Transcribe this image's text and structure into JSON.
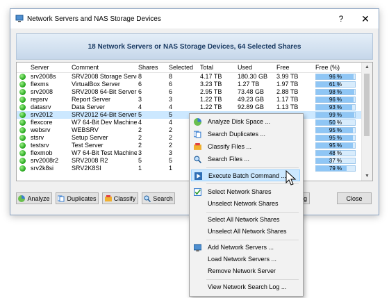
{
  "window": {
    "title": "Network Servers and NAS Storage Devices",
    "help": "?",
    "close": "✕"
  },
  "banner": "18 Network Servers or NAS Storage Devices, 64 Selected Shares",
  "columns": [
    "Server",
    "Comment",
    "Shares",
    "Selected",
    "Total",
    "Used",
    "Free",
    "Free (%)"
  ],
  "rows": [
    {
      "server": "srv2008s",
      "comment": "SRV2008 Storage Server",
      "shares": "8",
      "selected": "8",
      "total": "4.17 TB",
      "used": "180.30 GB",
      "free": "3.99 TB",
      "free_pct": "96 %",
      "fill": 96,
      "selected_row": false
    },
    {
      "server": "flexms",
      "comment": "VirtualBox Server",
      "shares": "6",
      "selected": "6",
      "total": "3.23 TB",
      "used": "1.27 TB",
      "free": "1.97 TB",
      "free_pct": "61 %",
      "fill": 61,
      "selected_row": false
    },
    {
      "server": "srv2008",
      "comment": "SRV2008 64-Bit Server",
      "shares": "6",
      "selected": "6",
      "total": "2.95 TB",
      "used": "73.48 GB",
      "free": "2.88 TB",
      "free_pct": "98 %",
      "fill": 98,
      "selected_row": false
    },
    {
      "server": "repsrv",
      "comment": "Report Server",
      "shares": "3",
      "selected": "3",
      "total": "1.22 TB",
      "used": "49.23 GB",
      "free": "1.17 TB",
      "free_pct": "96 %",
      "fill": 96,
      "selected_row": false
    },
    {
      "server": "datasrv",
      "comment": "Data Server",
      "shares": "4",
      "selected": "4",
      "total": "1.22 TB",
      "used": "92.89 GB",
      "free": "1.13 TB",
      "free_pct": "93 %",
      "fill": 93,
      "selected_row": false
    },
    {
      "server": "srv2012",
      "comment": "SRV2012 64-Bit Server",
      "shares": "5",
      "selected": "5",
      "total": "",
      "used": "",
      "free": "",
      "free_pct": "99 %",
      "fill": 99,
      "selected_row": true
    },
    {
      "server": "flexcore",
      "comment": "W7 64-Bit Dev Machine",
      "shares": "4",
      "selected": "4",
      "total": "",
      "used": "",
      "free": "",
      "free_pct": "50 %",
      "fill": 50,
      "selected_row": false
    },
    {
      "server": "websrv",
      "comment": "WEBSRV",
      "shares": "2",
      "selected": "2",
      "total": "",
      "used": "",
      "free": "",
      "free_pct": "95 %",
      "fill": 95,
      "selected_row": false
    },
    {
      "server": "stsrv",
      "comment": "Setup Server",
      "shares": "2",
      "selected": "2",
      "total": "",
      "used": "",
      "free": "",
      "free_pct": "95 %",
      "fill": 95,
      "selected_row": false
    },
    {
      "server": "testsrv",
      "comment": "Test Server",
      "shares": "2",
      "selected": "2",
      "total": "",
      "used": "",
      "free": "",
      "free_pct": "95 %",
      "fill": 95,
      "selected_row": false
    },
    {
      "server": "flexmob",
      "comment": "W7 64-Bit Test Machine",
      "shares": "3",
      "selected": "3",
      "total": "",
      "used": "",
      "free": "",
      "free_pct": "48 %",
      "fill": 48,
      "selected_row": false
    },
    {
      "server": "srv2008r2",
      "comment": "SRV2008 R2",
      "shares": "5",
      "selected": "5",
      "total": "",
      "used": "",
      "free": "",
      "free_pct": "37 %",
      "fill": 37,
      "selected_row": false
    },
    {
      "server": "srv2k8si",
      "comment": "SRV2K8SI",
      "shares": "1",
      "selected": "1",
      "total": "",
      "used": "",
      "free": "",
      "free_pct": "79 %",
      "fill": 79,
      "selected_row": false
    }
  ],
  "buttons": {
    "analyze": "Analyze",
    "duplicates": "Duplicates",
    "classify": "Classify",
    "search": "Search",
    "partial": "g",
    "close": "Close"
  },
  "menu": {
    "analyze": "Analyze Disk Space ...",
    "duplicates": "Search Duplicates ...",
    "classify": "Classify Files ...",
    "search_files": "Search Files ...",
    "batch": "Execute Batch Command ...",
    "select_shares": "Select Network Shares",
    "unselect_shares": "Unselect Network Shares",
    "select_all": "Select All Network Shares",
    "unselect_all": "Unselect All Network Shares",
    "add_servers": "Add Network Servers ...",
    "load_servers": "Load Network Servers ...",
    "remove_server": "Remove Network Server",
    "view_log": "View Network Search Log ..."
  },
  "icons": [
    "app-icon",
    "status-online-icon",
    "analyze-icon",
    "duplicates-icon",
    "classify-icon",
    "search-icon",
    "batch-icon",
    "select-icon",
    "add-server-icon",
    "mouse-cursor-icon"
  ],
  "colors": {
    "banner_text": "#1a3b63",
    "selection": "#cce8ff",
    "status_green": "#26a81d",
    "progress_fill": "#8fc6f5"
  }
}
